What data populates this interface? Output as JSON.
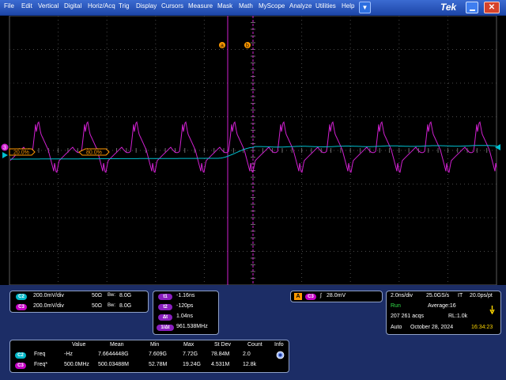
{
  "menu": [
    "File",
    "Edit",
    "Vertical",
    "Digital",
    "Horiz/Acq",
    "Trig",
    "Display",
    "Cursors",
    "Measure",
    "Mask",
    "Math",
    "MyScope",
    "Analyze",
    "Utilities",
    "Help"
  ],
  "dropdown_glyph": "▼",
  "brand": "Tek",
  "close_glyph": "✕",
  "colors": {
    "ch2": "#00c0d0",
    "ch3": "#d020d0",
    "cursor": "#ff9900",
    "trigger": "#ff9900",
    "grid": "#505050"
  },
  "scope": {
    "cursor_a_label": "a",
    "cursor_b_label": "b",
    "ref_c2_label": "20.0%",
    "ref_c3_label": "80.0%",
    "ch3_marker": "3"
  },
  "channels": [
    {
      "chip": "C2",
      "vdiv": "200.0mV/div",
      "imp": "50Ω",
      "bw": "8.0G"
    },
    {
      "chip": "C3",
      "vdiv": "200.0mV/div",
      "imp": "50Ω",
      "bw": "8.0G"
    }
  ],
  "bw_glyph": "Bw:",
  "cursor_readouts": [
    {
      "chip": "t1",
      "value": "-1.16ns"
    },
    {
      "chip": "t2",
      "value": "-120ps"
    },
    {
      "chip": "Δt",
      "value": "1.04ns"
    },
    {
      "chip": "1/Δt",
      "value": "961.538MHz"
    }
  ],
  "trigger": {
    "mode": "A",
    "chip": "C3",
    "slope": "∫",
    "level": "28.0mV"
  },
  "timebase": {
    "hdiv": "2.0ns/div",
    "sample": "25.0GS/s",
    "it": "IT",
    "ptpt": "20.0ps/pt",
    "state": "Run",
    "average": "Average:16",
    "acqs": "207 261 acqs",
    "rl": "RL:1.0k",
    "mode": "Auto",
    "date": "October 28, 2024",
    "time": "16:34:23"
  },
  "stats": {
    "headers": [
      "Value",
      "Mean",
      "Min",
      "Max",
      "St Dev",
      "Count",
      "Info"
    ],
    "rows": [
      {
        "chip": "C2",
        "name": "Freq",
        "cells": [
          "-Hz",
          "7.6644448G",
          "7.609G",
          "7.72G",
          "78.84M",
          "2.0"
        ]
      },
      {
        "chip": "C3",
        "name": "Freq*",
        "cells": [
          "500.0MHz",
          "500.03488M",
          "52.78M",
          "19.24G",
          "4.531M",
          "12.8k"
        ]
      }
    ]
  }
}
